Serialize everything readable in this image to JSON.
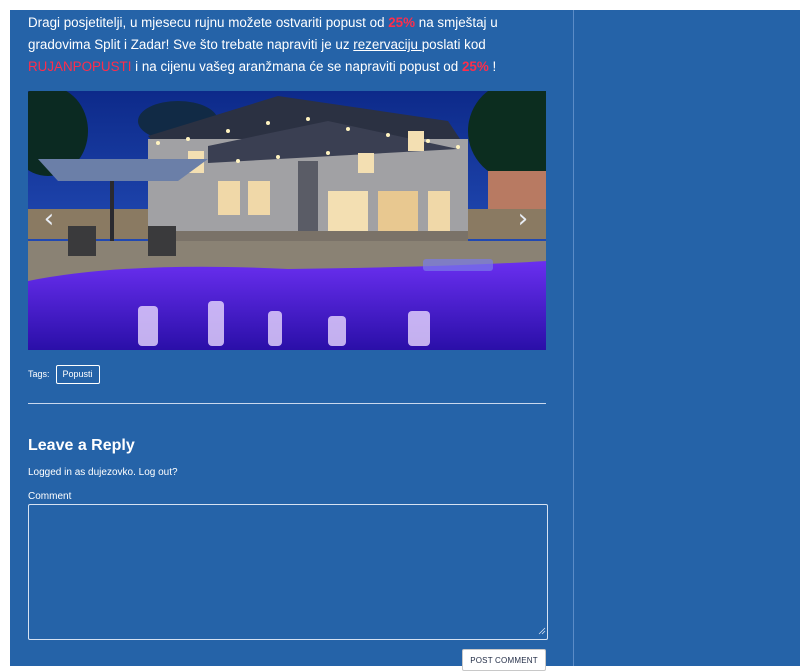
{
  "post": {
    "intro_1": "Dragi posjetitelji, u mjesecu rujnu možete ostvariti popust od ",
    "discount_1": "25%",
    "intro_2": " na smještaj u gradovima Split i Zadar! Sve što trebate napraviti je uz ",
    "reservation_link": "rezervaciju ",
    "intro_3": "poslati kod ",
    "promo_code": "RUJANPOPUSTI",
    "intro_4": " i na cijenu vašeg aranžmana će se napraviti popust od ",
    "discount_2": "25%",
    "intro_5": " !"
  },
  "slider": {
    "image_icon": "villa-pool-night-photo",
    "prev_icon": "chevron-left-icon",
    "next_icon": "chevron-right-icon",
    "prev_glyph": "‹",
    "next_glyph": "›"
  },
  "tags": {
    "label": "Tags:",
    "items": [
      "Popusti"
    ]
  },
  "reply": {
    "title": "Leave a Reply",
    "logged_in_text": "Logged in as dujezovko.",
    "logout_link": "Log out?",
    "comment_label": "Comment",
    "comment_value": "",
    "submit_label": "POST COMMENT"
  },
  "colors": {
    "page_background": "#2563a8",
    "accent_red": "#ff2d4b",
    "text": "#ffffff"
  }
}
